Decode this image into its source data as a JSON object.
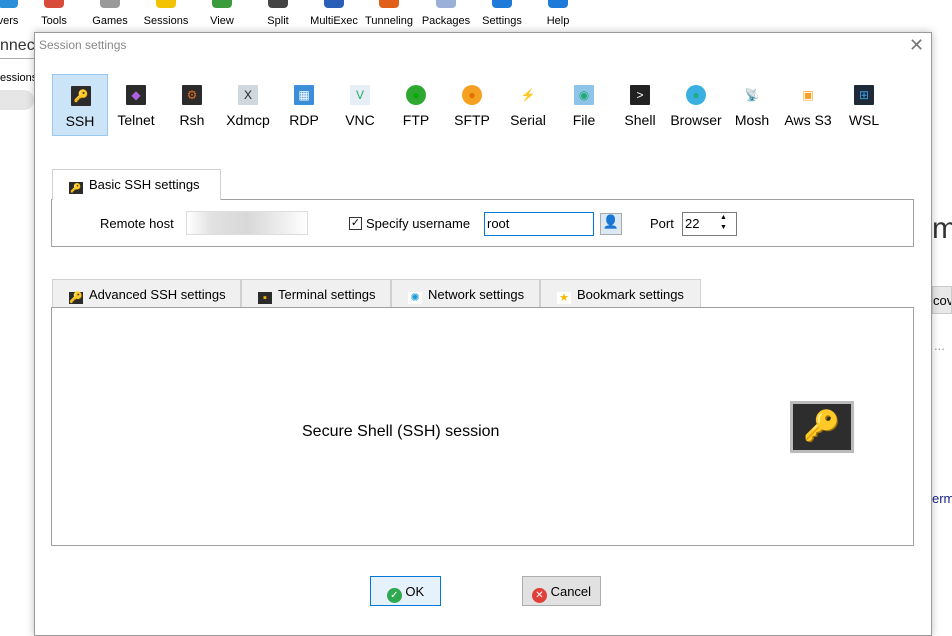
{
  "toolbar": {
    "items": [
      {
        "label": "vers",
        "color": "#2a8fd8"
      },
      {
        "label": "Tools",
        "color": "#d84a3a"
      },
      {
        "label": "Games",
        "color": "#999999"
      },
      {
        "label": "Sessions",
        "color": "#f2c200"
      },
      {
        "label": "View",
        "color": "#3c9b3c"
      },
      {
        "label": "Split",
        "color": "#444444"
      },
      {
        "label": "MultiExec",
        "color": "#2a5fb8"
      },
      {
        "label": "Tunneling",
        "color": "#e0601a"
      },
      {
        "label": "Packages",
        "color": "#9ab0d8"
      },
      {
        "label": "Settings",
        "color": "#1e7ad8"
      },
      {
        "label": "Help",
        "color": "#1e7ad8"
      }
    ]
  },
  "background": {
    "quick_connect": "nnect",
    "sessions_tab": "essions",
    "right_heading": "m",
    "right_button": "cove",
    "right_dots": "...",
    "right_link": "erm"
  },
  "dialog": {
    "title": "Session settings",
    "close_icon": "close-icon",
    "session_types": [
      {
        "label": "SSH",
        "icon": "key-icon",
        "selected": true
      },
      {
        "label": "Telnet",
        "icon": "telnet-icon"
      },
      {
        "label": "Rsh",
        "icon": "rsh-icon"
      },
      {
        "label": "Xdmcp",
        "icon": "xdmcp-icon"
      },
      {
        "label": "RDP",
        "icon": "rdp-icon"
      },
      {
        "label": "VNC",
        "icon": "vnc-icon"
      },
      {
        "label": "FTP",
        "icon": "ftp-globe-icon"
      },
      {
        "label": "SFTP",
        "icon": "sftp-globe-icon"
      },
      {
        "label": "Serial",
        "icon": "serial-plug-icon"
      },
      {
        "label": "File",
        "icon": "file-monitor-icon"
      },
      {
        "label": "Shell",
        "icon": "terminal-icon"
      },
      {
        "label": "Browser",
        "icon": "globe-icon"
      },
      {
        "label": "Mosh",
        "icon": "satellite-icon"
      },
      {
        "label": "Aws S3",
        "icon": "aws-boxes-icon"
      },
      {
        "label": "WSL",
        "icon": "windows-icon"
      }
    ],
    "basic_tab": "Basic SSH settings",
    "remote_host_label": "Remote host",
    "remote_host_value": "",
    "specify_username_label": "Specify username",
    "specify_username_checked": true,
    "username_value": "root",
    "port_label": "Port",
    "port_value": "22",
    "tabs": [
      {
        "label": "Advanced SSH settings"
      },
      {
        "label": "Terminal settings"
      },
      {
        "label": "Network settings"
      },
      {
        "label": "Bookmark settings"
      }
    ],
    "description": "Secure Shell (SSH) session",
    "ok_label": "OK",
    "cancel_label": "Cancel"
  }
}
